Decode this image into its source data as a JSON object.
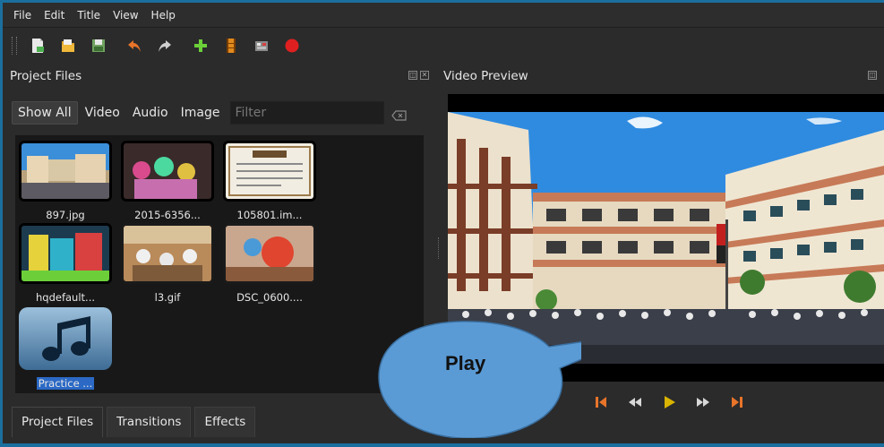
{
  "menu": [
    "File",
    "Edit",
    "Title",
    "View",
    "Help"
  ],
  "toolbar": {
    "icons": [
      "new-project-icon",
      "open-project-icon",
      "save-project-icon",
      "undo-icon",
      "redo-icon",
      "import-files-icon",
      "profile-icon",
      "fullscreen-icon",
      "record-icon"
    ]
  },
  "project_files": {
    "title": "Project Files",
    "filters": [
      "Show All",
      "Video",
      "Audio",
      "Image"
    ],
    "filter_placeholder": "Filter",
    "files": [
      {
        "name": "897.jpg"
      },
      {
        "name": "2015-6356..."
      },
      {
        "name": "105801.im..."
      },
      {
        "name": "hqdefault..."
      },
      {
        "name": "l3.gif"
      },
      {
        "name": "DSC_0600...."
      },
      {
        "name": "Practice ..."
      }
    ]
  },
  "video_preview": {
    "title": "Video Preview"
  },
  "bottom_tabs": [
    "Project Files",
    "Transitions",
    "Effects"
  ],
  "callout": {
    "text": "Play"
  },
  "colors": {
    "background": "#2b2b2b",
    "accent_selection": "#2b69c5",
    "transport_orange": "#e8742a",
    "transport_play": "#d9b400",
    "callout_fill": "#5b9bd5"
  }
}
